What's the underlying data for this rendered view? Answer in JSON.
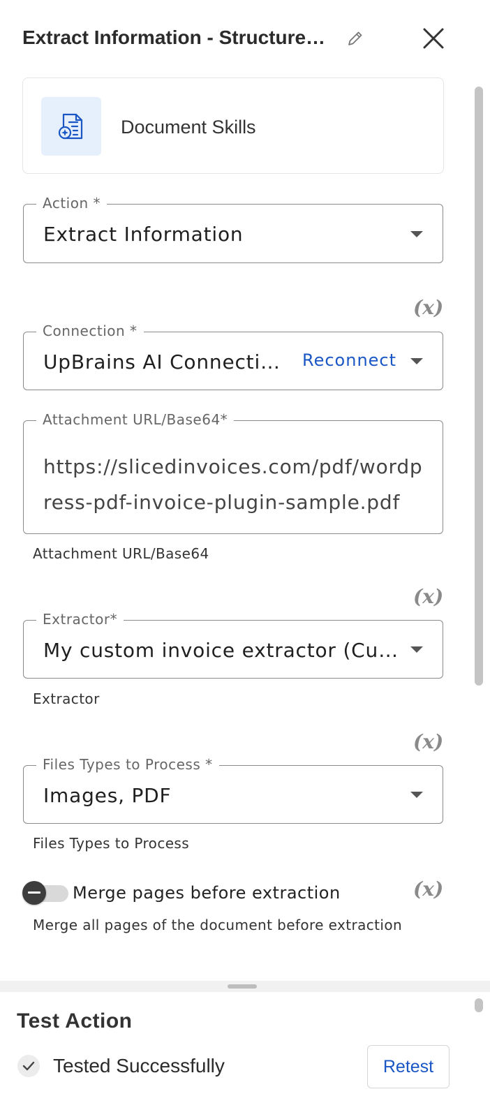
{
  "header": {
    "title": "Extract Information - Structure…"
  },
  "card": {
    "label": "Document Skills",
    "icon": "document-ai-icon"
  },
  "fields": {
    "action": {
      "label": "Action *",
      "value": "Extract Information"
    },
    "connection": {
      "label": "Connection *",
      "value": "UpBrains AI Connectio…",
      "reconnect_label": "Reconnect",
      "variable_badge": "(x)"
    },
    "attachment": {
      "label": "Attachment URL/Base64*",
      "value": "https://slicedinvoices.com/pdf/wordpress-pdf-invoice-plugin-sample.pdf",
      "helper": "Attachment URL/Base64"
    },
    "extractor": {
      "label": "Extractor*",
      "value": "My custom invoice extractor (Custo…",
      "helper": "Extractor",
      "variable_badge": "(x)"
    },
    "file_types": {
      "label": "Files Types to Process *",
      "value": "Images, PDF",
      "helper": "Files Types to Process",
      "variable_badge": "(x)"
    },
    "merge_pages": {
      "label": "Merge pages before extraction",
      "helper": "Merge all pages of the document before extraction",
      "enabled": false,
      "variable_badge": "(x)"
    }
  },
  "test": {
    "title": "Test Action",
    "status": "Tested Successfully",
    "retest_label": "Retest"
  },
  "colors": {
    "accent": "#1a56c4",
    "icon_bg": "#e6f0fc"
  }
}
